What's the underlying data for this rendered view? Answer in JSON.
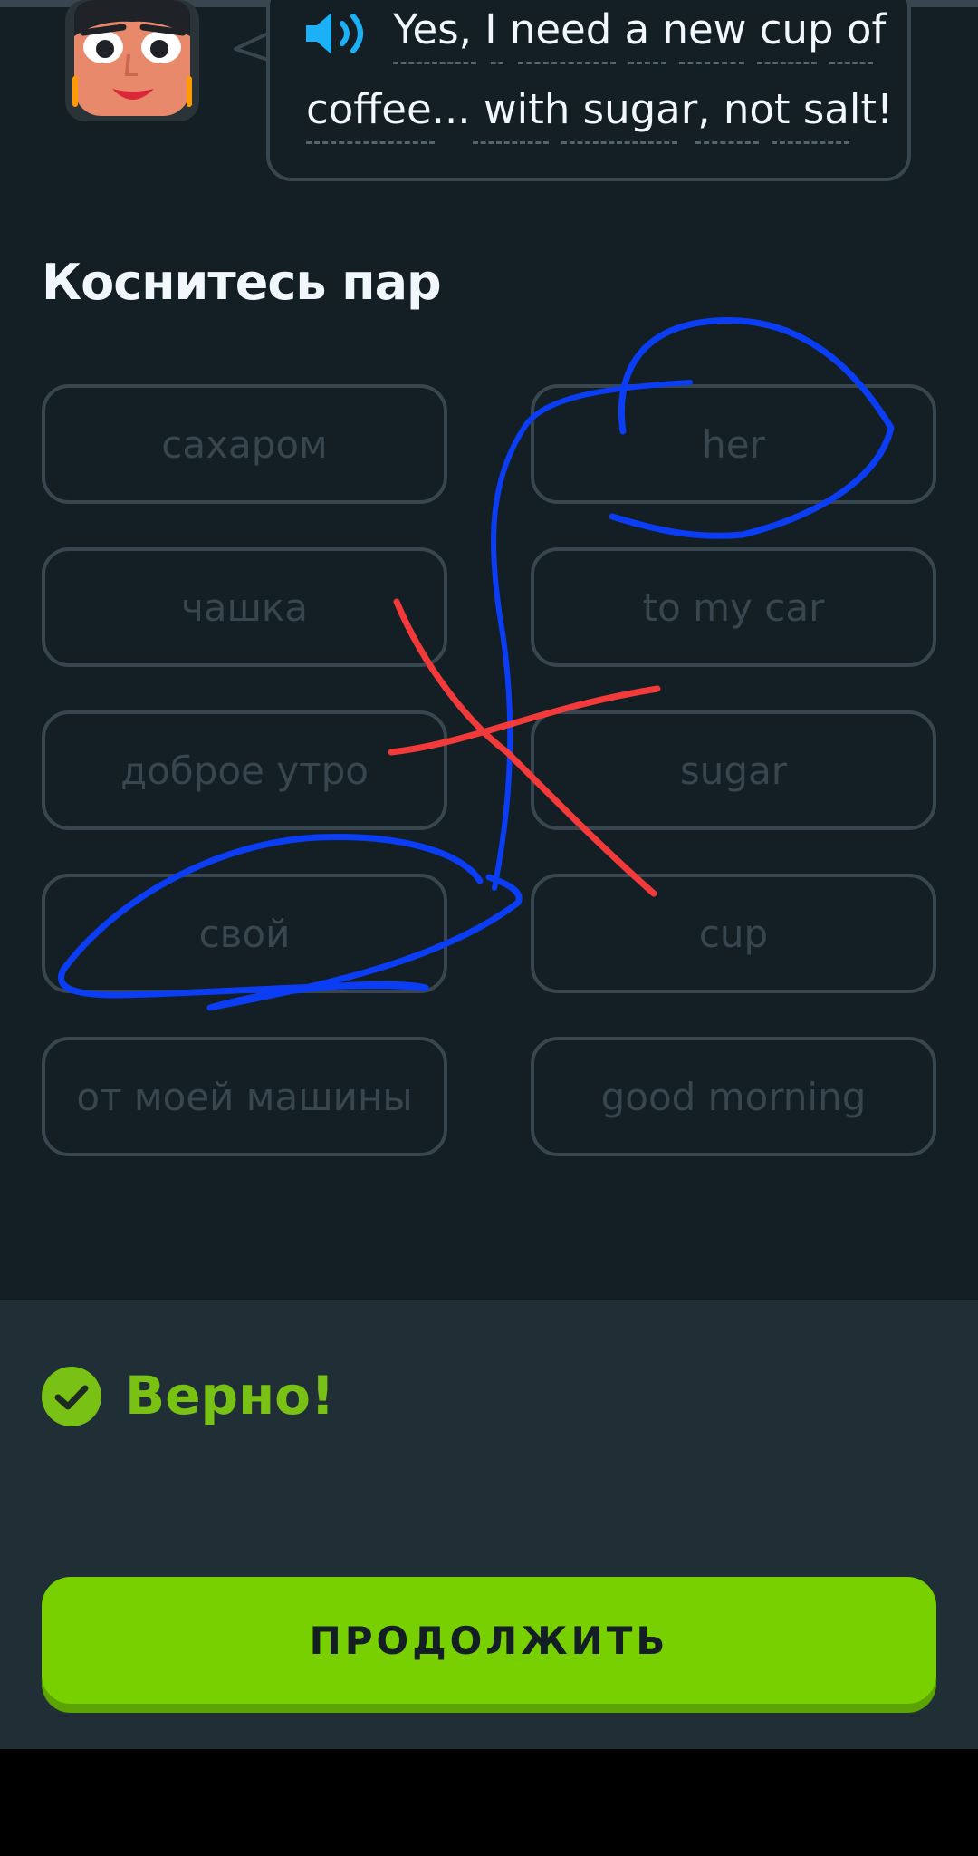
{
  "dialog": {
    "line1": "Yes, I need a new cup of",
    "line2": "coffee... with sugar, not salt!"
  },
  "prompt": "Коснитесь пар",
  "tiles": {
    "left": [
      "сахаром",
      "чашка",
      "доброе утро",
      "свой",
      "от моей машины"
    ],
    "right": [
      "her",
      "to my car",
      "sugar",
      "cup",
      "good morning"
    ]
  },
  "feedback": {
    "text": "Верно!"
  },
  "continue_label": "ПРОДОЛЖИТЬ",
  "colors": {
    "background": "#131f24",
    "tile_border": "#37464f",
    "success_green": "#79c114",
    "button_green": "#79d000",
    "panel": "#202f36",
    "scribble_blue": "#0b3df5",
    "scribble_red": "#f23a3a"
  }
}
